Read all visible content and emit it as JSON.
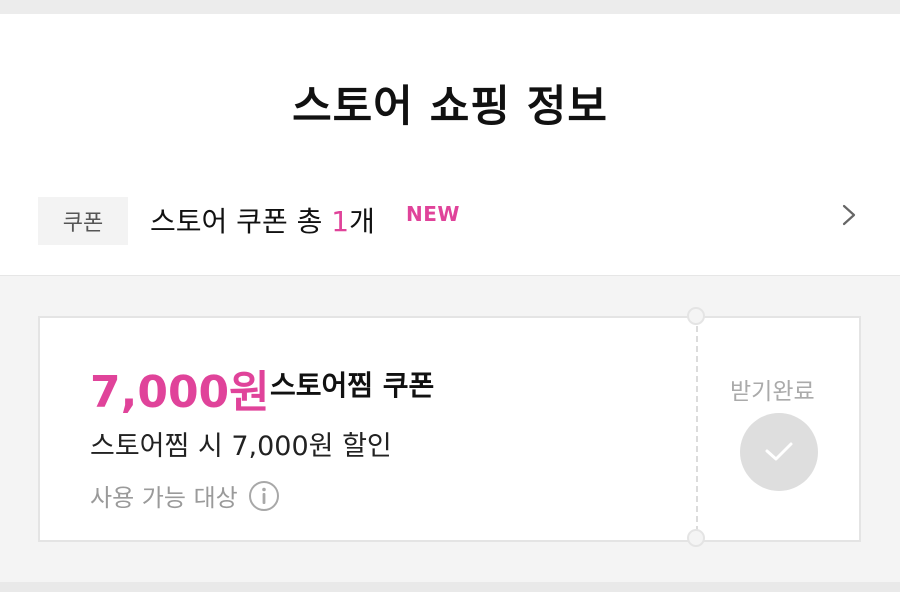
{
  "header": {
    "title": "스토어 쇼핑 정보"
  },
  "coupon_row": {
    "tag": "쿠폰",
    "summary_prefix": "스토어 쿠폰 총 ",
    "count": "1",
    "summary_suffix": "개",
    "new_badge": "NEW",
    "icon": "chevron-right-icon"
  },
  "coupon_card": {
    "amount": "7,000원",
    "name": "스토어찜 쿠폰",
    "description": "스토어찜 시 7,000원 할인",
    "target_label": "사용 가능 대상",
    "target_icon": "info-icon",
    "status_label": "받기완료",
    "status_icon": "check-icon"
  },
  "colors": {
    "accent": "#e0439a",
    "muted": "#9a9a9a",
    "check_bg": "#dedede"
  }
}
